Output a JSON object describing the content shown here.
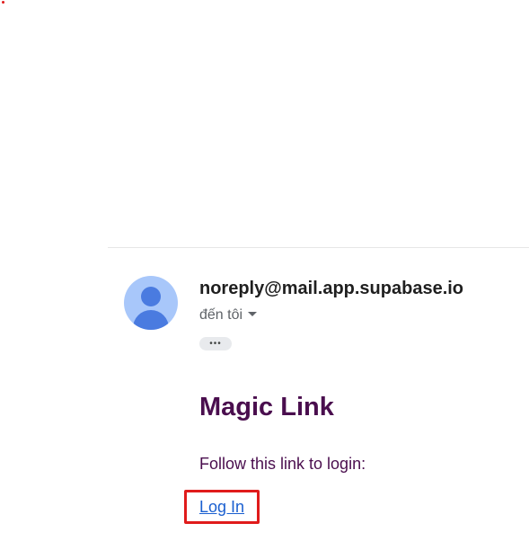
{
  "email": {
    "sender": "noreply@mail.app.supabase.io",
    "recipient": "đến tôi",
    "more_chip": "•••",
    "title": "Magic Link",
    "instruction": "Follow this link to login:",
    "login_link": "Log In"
  },
  "colors": {
    "title": "#4a0e4e",
    "link": "#1a5fd0",
    "highlight": "#e01b1b",
    "avatar_bg": "#a8c7fa",
    "avatar_fg": "#4a7be0"
  },
  "icons": {
    "avatar": "person-avatar-icon",
    "recipient_toggle": "caret-down-icon"
  }
}
